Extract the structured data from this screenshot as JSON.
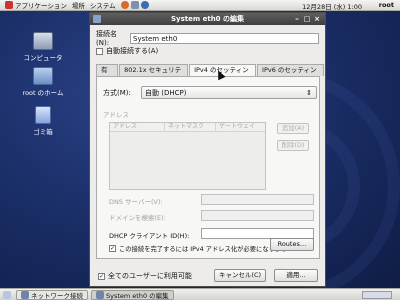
{
  "topbar": {
    "applications": "アプリケーション",
    "places": "場所",
    "system": "システム",
    "clock": "12月28日 (水) 1:00",
    "user": "root"
  },
  "desktop_icons": [
    {
      "label": "コンピュータ",
      "icon": "computer-icon"
    },
    {
      "label": "root のホーム",
      "icon": "home-folder-icon"
    },
    {
      "label": "ゴミ箱",
      "icon": "trash-icon"
    }
  ],
  "window": {
    "title": "System eth0 の編集",
    "connection_name_label": "接続名(N):",
    "connection_name_value": "System eth0",
    "auto_connect_label": "自動接続する(A)",
    "tabs": [
      "有線",
      "802.1x セキュリティ",
      "IPv4 のセッティング",
      "IPv6 のセッティング"
    ],
    "method_label": "方式(M):",
    "method_value": "自動 (DHCP)",
    "address_section": "アドレス",
    "address_columns": [
      "アドレス",
      "ネットマスク",
      "ゲートウェイ"
    ],
    "add_button": "追加(A)",
    "delete_button": "削除(D)",
    "dns_label": "DNS サーバー(V):",
    "search_domain_label": "ドメインを検索(E):",
    "dhcp_client_id_label": "DHCP クライアント ID(H):",
    "require_ipv4_label": "この接続を完了するには IPv4 アドレス化が必要になります",
    "routes_button": "Routes…",
    "available_all_users": "全てのユーザーに利用可能",
    "cancel_button": "キャンセル(C)",
    "apply_button": "適用..."
  },
  "taskbar": {
    "items": [
      "ネットワーク接続",
      "System eth0 の編集"
    ]
  },
  "colors": {
    "desktop_bg": "#1b2f69",
    "titlebar_bg": "#4a4a4a"
  }
}
